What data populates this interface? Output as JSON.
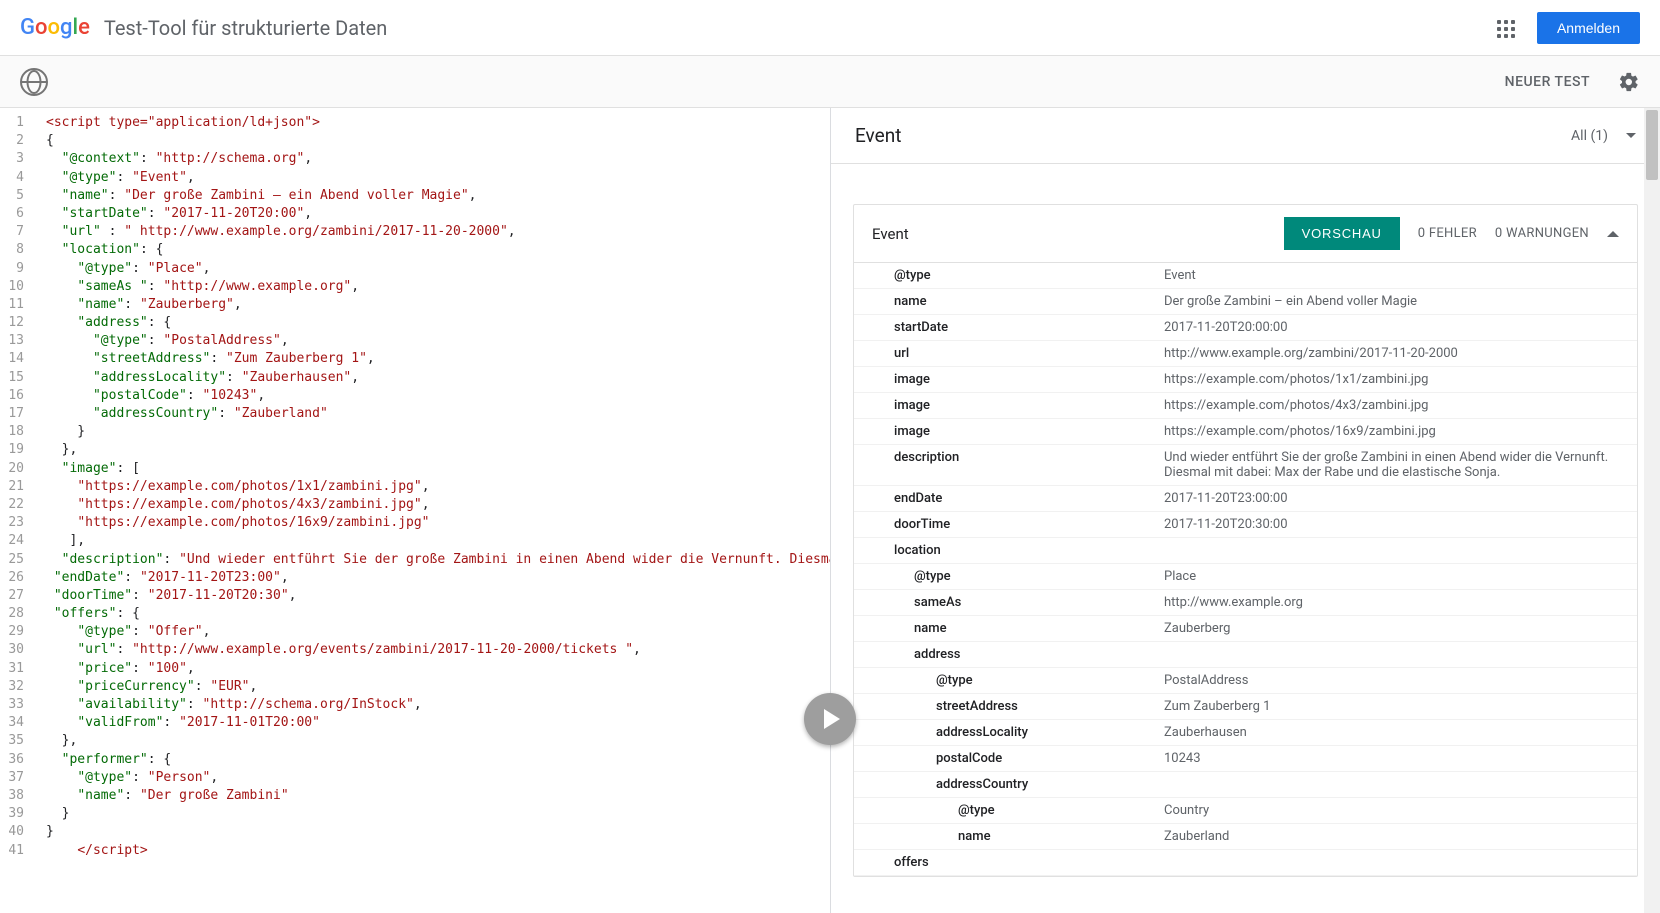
{
  "header": {
    "title": "Test-Tool für strukturierte Daten",
    "signin": "Anmelden"
  },
  "toolbar": {
    "new_test": "NEUER TEST"
  },
  "code_lines": [
    [
      [
        "tag",
        "<script type=\"application/ld+json\">"
      ]
    ],
    [
      [
        "p",
        "{"
      ]
    ],
    [
      [
        "p",
        "  "
      ],
      [
        "key",
        "\"@context\""
      ],
      [
        "p",
        ": "
      ],
      [
        "str",
        "\"http://schema.org\""
      ],
      [
        "p",
        ","
      ]
    ],
    [
      [
        "p",
        "  "
      ],
      [
        "key",
        "\"@type\""
      ],
      [
        "p",
        ": "
      ],
      [
        "str",
        "\"Event\""
      ],
      [
        "p",
        ","
      ]
    ],
    [
      [
        "p",
        "  "
      ],
      [
        "key",
        "\"name\""
      ],
      [
        "p",
        ": "
      ],
      [
        "str",
        "\"Der große Zambini – ein Abend voller Magie\""
      ],
      [
        "p",
        ","
      ]
    ],
    [
      [
        "p",
        "  "
      ],
      [
        "key",
        "\"startDate\""
      ],
      [
        "p",
        ": "
      ],
      [
        "str",
        "\"2017-11-20T20:00\""
      ],
      [
        "p",
        ","
      ]
    ],
    [
      [
        "p",
        "  "
      ],
      [
        "key",
        "\"url\""
      ],
      [
        "p",
        " : "
      ],
      [
        "str",
        "\" http://www.example.org/zambini/2017-11-20-2000\""
      ],
      [
        "p",
        ","
      ]
    ],
    [
      [
        "p",
        "  "
      ],
      [
        "key",
        "\"location\""
      ],
      [
        "p",
        ": {"
      ]
    ],
    [
      [
        "p",
        "    "
      ],
      [
        "key",
        "\"@type\""
      ],
      [
        "p",
        ": "
      ],
      [
        "str",
        "\"Place\""
      ],
      [
        "p",
        ","
      ]
    ],
    [
      [
        "p",
        "    "
      ],
      [
        "key",
        "\"sameAs \""
      ],
      [
        "p",
        ": "
      ],
      [
        "str",
        "\"http://www.example.org\""
      ],
      [
        "p",
        ","
      ]
    ],
    [
      [
        "p",
        "    "
      ],
      [
        "key",
        "\"name\""
      ],
      [
        "p",
        ": "
      ],
      [
        "str",
        "\"Zauberberg\""
      ],
      [
        "p",
        ","
      ]
    ],
    [
      [
        "p",
        "    "
      ],
      [
        "key",
        "\"address\""
      ],
      [
        "p",
        ": {"
      ]
    ],
    [
      [
        "p",
        "      "
      ],
      [
        "key",
        "\"@type\""
      ],
      [
        "p",
        ": "
      ],
      [
        "str",
        "\"PostalAddress\""
      ],
      [
        "p",
        ","
      ]
    ],
    [
      [
        "p",
        "      "
      ],
      [
        "key",
        "\"streetAddress\""
      ],
      [
        "p",
        ": "
      ],
      [
        "str",
        "\"Zum Zauberberg 1\""
      ],
      [
        "p",
        ","
      ]
    ],
    [
      [
        "p",
        "      "
      ],
      [
        "key",
        "\"addressLocality\""
      ],
      [
        "p",
        ": "
      ],
      [
        "str",
        "\"Zauberhausen\""
      ],
      [
        "p",
        ","
      ]
    ],
    [
      [
        "p",
        "      "
      ],
      [
        "key",
        "\"postalCode\""
      ],
      [
        "p",
        ": "
      ],
      [
        "str",
        "\"10243\""
      ],
      [
        "p",
        ","
      ]
    ],
    [
      [
        "p",
        "      "
      ],
      [
        "key",
        "\"addressCountry\""
      ],
      [
        "p",
        ": "
      ],
      [
        "str",
        "\"Zauberland\""
      ]
    ],
    [
      [
        "p",
        "    }"
      ]
    ],
    [
      [
        "p",
        "  },"
      ]
    ],
    [
      [
        "p",
        "  "
      ],
      [
        "key",
        "\"image\""
      ],
      [
        "p",
        ": ["
      ]
    ],
    [
      [
        "p",
        "    "
      ],
      [
        "str",
        "\"https://example.com/photos/1x1/zambini.jpg\""
      ],
      [
        "p",
        ","
      ]
    ],
    [
      [
        "p",
        "    "
      ],
      [
        "str",
        "\"https://example.com/photos/4x3/zambini.jpg\""
      ],
      [
        "p",
        ","
      ]
    ],
    [
      [
        "p",
        "    "
      ],
      [
        "str",
        "\"https://example.com/photos/16x9/zambini.jpg\""
      ]
    ],
    [
      [
        "p",
        "   ],"
      ]
    ],
    [
      [
        "p",
        "  "
      ],
      [
        "key",
        "\"description\""
      ],
      [
        "p",
        ": "
      ],
      [
        "str",
        "\"Und wieder entführt Sie der große Zambini in einen Abend wider die Vernunft. Diesmal mit dabei: Max der Rabe und die elastische Sonja.\""
      ],
      [
        "p",
        ","
      ]
    ],
    [
      [
        "p",
        " "
      ],
      [
        "key",
        "\"endDate\""
      ],
      [
        "p",
        ": "
      ],
      [
        "str",
        "\"2017-11-20T23:00\""
      ],
      [
        "p",
        ","
      ]
    ],
    [
      [
        "p",
        " "
      ],
      [
        "key",
        "\"doorTime\""
      ],
      [
        "p",
        ": "
      ],
      [
        "str",
        "\"2017-11-20T20:30\""
      ],
      [
        "p",
        ","
      ]
    ],
    [
      [
        "p",
        " "
      ],
      [
        "key",
        "\"offers\""
      ],
      [
        "p",
        ": {"
      ]
    ],
    [
      [
        "p",
        "    "
      ],
      [
        "key",
        "\"@type\""
      ],
      [
        "p",
        ": "
      ],
      [
        "str",
        "\"Offer\""
      ],
      [
        "p",
        ","
      ]
    ],
    [
      [
        "p",
        "    "
      ],
      [
        "key",
        "\"url\""
      ],
      [
        "p",
        ": "
      ],
      [
        "str",
        "\"http://www.example.org/events/zambini/2017-11-20-2000/tickets \""
      ],
      [
        "p",
        ","
      ]
    ],
    [
      [
        "p",
        "    "
      ],
      [
        "key",
        "\"price\""
      ],
      [
        "p",
        ": "
      ],
      [
        "str",
        "\"100\""
      ],
      [
        "p",
        ","
      ]
    ],
    [
      [
        "p",
        "    "
      ],
      [
        "key",
        "\"priceCurrency\""
      ],
      [
        "p",
        ": "
      ],
      [
        "str",
        "\"EUR\""
      ],
      [
        "p",
        ","
      ]
    ],
    [
      [
        "p",
        "    "
      ],
      [
        "key",
        "\"availability\""
      ],
      [
        "p",
        ": "
      ],
      [
        "str",
        "\"http://schema.org/InStock\""
      ],
      [
        "p",
        ","
      ]
    ],
    [
      [
        "p",
        "    "
      ],
      [
        "key",
        "\"validFrom\""
      ],
      [
        "p",
        ": "
      ],
      [
        "str",
        "\"2017-11-01T20:00\""
      ]
    ],
    [
      [
        "p",
        "  },"
      ]
    ],
    [
      [
        "p",
        "  "
      ],
      [
        "key",
        "\"performer\""
      ],
      [
        "p",
        ": {"
      ]
    ],
    [
      [
        "p",
        "    "
      ],
      [
        "key",
        "\"@type\""
      ],
      [
        "p",
        ": "
      ],
      [
        "str",
        "\"Person\""
      ],
      [
        "p",
        ","
      ]
    ],
    [
      [
        "p",
        "    "
      ],
      [
        "key",
        "\"name\""
      ],
      [
        "p",
        ": "
      ],
      [
        "str",
        "\"Der große Zambini\""
      ]
    ],
    [
      [
        "p",
        "  }"
      ]
    ],
    [
      [
        "p",
        "}"
      ]
    ],
    [
      [
        "p",
        "    "
      ],
      [
        "tag",
        "</script>"
      ]
    ]
  ],
  "results": {
    "title": "Event",
    "filter": "All (1)",
    "card": {
      "title": "Event",
      "preview": "VORSCHAU",
      "errors": "0 FEHLER",
      "warnings": "0 WARNUNGEN"
    },
    "rows": [
      {
        "k": "@type",
        "v": "Event",
        "i": 0
      },
      {
        "k": "name",
        "v": "Der große Zambini – ein Abend voller Magie",
        "i": 0
      },
      {
        "k": "startDate",
        "v": "2017-11-20T20:00:00",
        "i": 0
      },
      {
        "k": "url",
        "v": "http://www.example.org/zambini/2017-11-20-2000",
        "i": 0
      },
      {
        "k": "image",
        "v": "https://example.com/photos/1x1/zambini.jpg",
        "i": 0
      },
      {
        "k": "image",
        "v": "https://example.com/photos/4x3/zambini.jpg",
        "i": 0
      },
      {
        "k": "image",
        "v": "https://example.com/photos/16x9/zambini.jpg",
        "i": 0
      },
      {
        "k": "description",
        "v": "Und wieder entführt Sie der große Zambini in einen Abend wider die Vernunft. Diesmal mit dabei: Max der Rabe und die elastische Sonja.",
        "i": 0
      },
      {
        "k": "endDate",
        "v": "2017-11-20T23:00:00",
        "i": 0
      },
      {
        "k": "doorTime",
        "v": "2017-11-20T20:30:00",
        "i": 0
      },
      {
        "k": "location",
        "v": "",
        "i": 0
      },
      {
        "k": "@type",
        "v": "Place",
        "i": 1
      },
      {
        "k": "sameAs",
        "v": "http://www.example.org",
        "i": 1
      },
      {
        "k": "name",
        "v": "Zauberberg",
        "i": 1
      },
      {
        "k": "address",
        "v": "",
        "i": 1
      },
      {
        "k": "@type",
        "v": "PostalAddress",
        "i": 2
      },
      {
        "k": "streetAddress",
        "v": "Zum Zauberberg 1",
        "i": 2
      },
      {
        "k": "addressLocality",
        "v": "Zauberhausen",
        "i": 2
      },
      {
        "k": "postalCode",
        "v": "10243",
        "i": 2
      },
      {
        "k": "addressCountry",
        "v": "",
        "i": 2
      },
      {
        "k": "@type",
        "v": "Country",
        "i": 3
      },
      {
        "k": "name",
        "v": "Zauberland",
        "i": 3
      },
      {
        "k": "offers",
        "v": "",
        "i": 0
      }
    ]
  }
}
